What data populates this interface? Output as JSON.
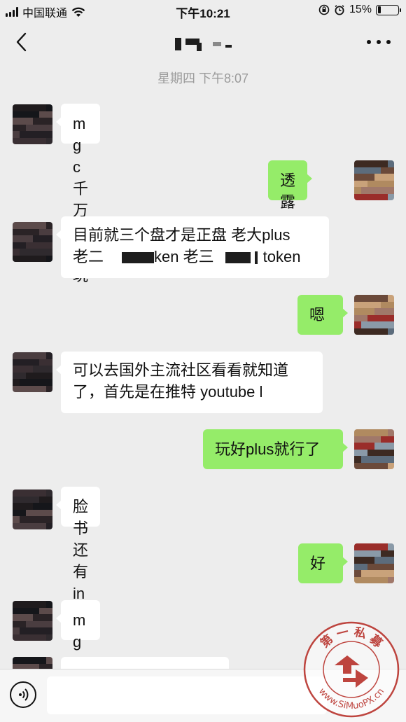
{
  "status_bar": {
    "carrier": "中国联通",
    "time": "下午10:21",
    "battery_percent": "15%",
    "battery_level": 0.15,
    "icons": [
      "signal-icon",
      "wifi-icon",
      "orientation-lock-icon",
      "alarm-icon",
      "battery-icon"
    ]
  },
  "nav": {
    "title_state": "redacted",
    "icons": [
      "back-chevron-icon",
      "more-dots-icon"
    ]
  },
  "chat": {
    "timestamp": "星期四 下午8:07",
    "messages": [
      {
        "side": "in",
        "text": "mgc千万不能玩"
      },
      {
        "side": "out",
        "text": "透露下"
      },
      {
        "side": "in",
        "line1": "目前就三个盘才是正盘 老大plus",
        "line2a": "老二",
        "line2b": "ken 老三",
        "line2c": "token"
      },
      {
        "side": "out",
        "text": "嗯"
      },
      {
        "side": "in",
        "line1": "可以去国外主流社区看看就知道",
        "line2": "了，首先是在推特 youtube l"
      },
      {
        "side": "out",
        "text": "玩好plus就行了"
      },
      {
        "side": "in",
        "text": "脸书还有ins"
      },
      {
        "side": "out",
        "text": "好"
      },
      {
        "side": "in",
        "text": "mgc尽量跑吧"
      }
    ]
  },
  "input_bar": {
    "value": "",
    "icons": [
      "voice-icon"
    ]
  },
  "watermark": {
    "top_text": "第 一 私 募",
    "url_text": "www.SiMuoPX.cn"
  },
  "colors": {
    "background": "#ededed",
    "incoming_bubble": "#ffffff",
    "outgoing_bubble": "#95ec69",
    "timestamp": "#9b9b9b",
    "watermark_red": "#b8322c"
  }
}
